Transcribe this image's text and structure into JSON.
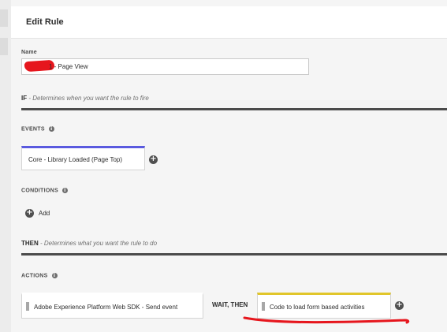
{
  "header": {
    "title": "Edit Rule"
  },
  "name_field": {
    "label": "Name",
    "value": "1 - Page View"
  },
  "if_section": {
    "keyword": "IF",
    "description": " - Determines when you want the rule to fire"
  },
  "events": {
    "label": "EVENTS",
    "items": [
      {
        "label": "Core - Library Loaded (Page Top)",
        "accent": "#5a5adf"
      }
    ]
  },
  "conditions": {
    "label": "CONDITIONS",
    "add_label": "Add"
  },
  "then_section": {
    "keyword": "THEN",
    "description": " - Determines what you want the rule to do"
  },
  "actions": {
    "label": "ACTIONS",
    "items": [
      {
        "label": "Adobe Experience Platform Web SDK - Send event"
      },
      {
        "label": "Code to load form based activities",
        "accent": "#e1c62b"
      }
    ],
    "separator": "WAIT, THEN"
  },
  "icons": {
    "info": "info-icon",
    "add": "plus-circle-icon",
    "drag": "drag-handle-icon"
  },
  "annotation_colors": {
    "redaction": "#e6161d",
    "underline": "#e6161d"
  }
}
